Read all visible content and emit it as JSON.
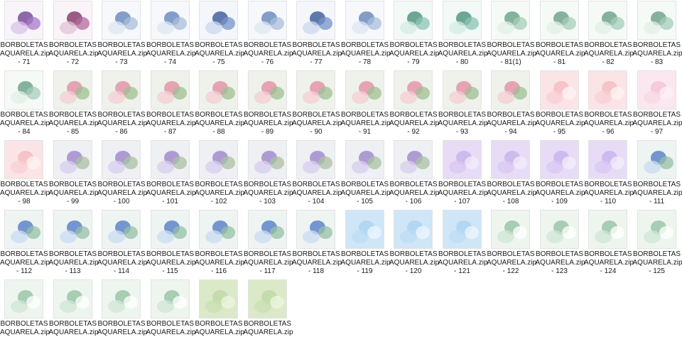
{
  "items": [
    {
      "name_line1": "BORBOLETAS",
      "name_line2": "AQUARELA.zip",
      "name_line3": "- 71",
      "theme": "purple-bouquet"
    },
    {
      "name_line1": "BORBOLETAS",
      "name_line2": "AQUARELA.zip",
      "name_line3": "- 72",
      "theme": "magenta-bouquet"
    },
    {
      "name_line1": "BORBOLETAS",
      "name_line2": "AQUARELA.zip",
      "name_line3": "- 73",
      "theme": "blue-bouquet"
    },
    {
      "name_line1": "BORBOLETAS",
      "name_line2": "AQUARELA.zip",
      "name_line3": "- 74",
      "theme": "blue-bouquet"
    },
    {
      "name_line1": "BORBOLETAS",
      "name_line2": "AQUARELA.zip",
      "name_line3": "- 75",
      "theme": "navy-bouquet"
    },
    {
      "name_line1": "BORBOLETAS",
      "name_line2": "AQUARELA.zip",
      "name_line3": "- 76",
      "theme": "blue-bouquet"
    },
    {
      "name_line1": "BORBOLETAS",
      "name_line2": "AQUARELA.zip",
      "name_line3": "- 77",
      "theme": "navy-bouquet"
    },
    {
      "name_line1": "BORBOLETAS",
      "name_line2": "AQUARELA.zip",
      "name_line3": "- 78",
      "theme": "blue-bouquet"
    },
    {
      "name_line1": "BORBOLETAS",
      "name_line2": "AQUARELA.zip",
      "name_line3": "- 79",
      "theme": "teal-bouquet"
    },
    {
      "name_line1": "BORBOLETAS",
      "name_line2": "AQUARELA.zip",
      "name_line3": "- 80",
      "theme": "teal-bouquet"
    },
    {
      "name_line1": "BORBOLETAS",
      "name_line2": "AQUARELA.zip",
      "name_line3": "- 81(1)",
      "theme": "green-bouquet"
    },
    {
      "name_line1": "BORBOLETAS",
      "name_line2": "AQUARELA.zip",
      "name_line3": "- 81",
      "theme": "green-bouquet"
    },
    {
      "name_line1": "BORBOLETAS",
      "name_line2": "AQUARELA.zip",
      "name_line3": "- 82",
      "theme": "green-bouquet"
    },
    {
      "name_line1": "BORBOLETAS",
      "name_line2": "AQUARELA.zip",
      "name_line3": "- 83",
      "theme": "green-bouquet"
    },
    {
      "name_line1": "BORBOLETAS",
      "name_line2": "AQUARELA.zip",
      "name_line3": "- 84",
      "theme": "green-bouquet"
    },
    {
      "name_line1": "BORBOLETAS",
      "name_line2": "AQUARELA.zip",
      "name_line3": "- 85",
      "theme": "pink-garden"
    },
    {
      "name_line1": "BORBOLETAS",
      "name_line2": "AQUARELA.zip",
      "name_line3": "- 86",
      "theme": "pink-garden"
    },
    {
      "name_line1": "BORBOLETAS",
      "name_line2": "AQUARELA.zip",
      "name_line3": "- 87",
      "theme": "pink-garden"
    },
    {
      "name_line1": "BORBOLETAS",
      "name_line2": "AQUARELA.zip",
      "name_line3": "- 88",
      "theme": "pink-garden"
    },
    {
      "name_line1": "BORBOLETAS",
      "name_line2": "AQUARELA.zip",
      "name_line3": "- 89",
      "theme": "pink-garden"
    },
    {
      "name_line1": "BORBOLETAS",
      "name_line2": "AQUARELA.zip",
      "name_line3": "- 90",
      "theme": "pink-garden"
    },
    {
      "name_line1": "BORBOLETAS",
      "name_line2": "AQUARELA.zip",
      "name_line3": "- 91",
      "theme": "pink-garden"
    },
    {
      "name_line1": "BORBOLETAS",
      "name_line2": "AQUARELA.zip",
      "name_line3": "- 92",
      "theme": "pink-garden"
    },
    {
      "name_line1": "BORBOLETAS",
      "name_line2": "AQUARELA.zip",
      "name_line3": "- 93",
      "theme": "pink-garden"
    },
    {
      "name_line1": "BORBOLETAS",
      "name_line2": "AQUARELA.zip",
      "name_line3": "- 94",
      "theme": "pink-garden"
    },
    {
      "name_line1": "BORBOLETAS",
      "name_line2": "AQUARELA.zip",
      "name_line3": "- 95",
      "theme": "pink-paper"
    },
    {
      "name_line1": "BORBOLETAS",
      "name_line2": "AQUARELA.zip",
      "name_line3": "- 96",
      "theme": "pink-paper"
    },
    {
      "name_line1": "BORBOLETAS",
      "name_line2": "AQUARELA.zip",
      "name_line3": "- 97",
      "theme": "pink-grid"
    },
    {
      "name_line1": "BORBOLETAS",
      "name_line2": "AQUARELA.zip",
      "name_line3": "- 98",
      "theme": "pink-paper"
    },
    {
      "name_line1": "BORBOLETAS",
      "name_line2": "AQUARELA.zip",
      "name_line3": "- 99",
      "theme": "lavender-garden"
    },
    {
      "name_line1": "BORBOLETAS",
      "name_line2": "AQUARELA.zip",
      "name_line3": "- 100",
      "theme": "lavender-garden"
    },
    {
      "name_line1": "BORBOLETAS",
      "name_line2": "AQUARELA.zip",
      "name_line3": "- 101",
      "theme": "lavender-garden"
    },
    {
      "name_line1": "BORBOLETAS",
      "name_line2": "AQUARELA.zip",
      "name_line3": "- 102",
      "theme": "lavender-garden"
    },
    {
      "name_line1": "BORBOLETAS",
      "name_line2": "AQUARELA.zip",
      "name_line3": "- 103",
      "theme": "lavender-garden"
    },
    {
      "name_line1": "BORBOLETAS",
      "name_line2": "AQUARELA.zip",
      "name_line3": "- 104",
      "theme": "lavender-garden"
    },
    {
      "name_line1": "BORBOLETAS",
      "name_line2": "AQUARELA.zip",
      "name_line3": "- 105",
      "theme": "lavender-garden"
    },
    {
      "name_line1": "BORBOLETAS",
      "name_line2": "AQUARELA.zip",
      "name_line3": "- 106",
      "theme": "lavender-garden"
    },
    {
      "name_line1": "BORBOLETAS",
      "name_line2": "AQUARELA.zip",
      "name_line3": "- 107",
      "theme": "lilac-paper"
    },
    {
      "name_line1": "BORBOLETAS",
      "name_line2": "AQUARELA.zip",
      "name_line3": "- 108",
      "theme": "lilac-paper"
    },
    {
      "name_line1": "BORBOLETAS",
      "name_line2": "AQUARELA.zip",
      "name_line3": "- 109",
      "theme": "lilac-paper"
    },
    {
      "name_line1": "BORBOLETAS",
      "name_line2": "AQUARELA.zip",
      "name_line3": "- 110",
      "theme": "lilac-paper"
    },
    {
      "name_line1": "BORBOLETAS",
      "name_line2": "AQUARELA.zip",
      "name_line3": "- 111",
      "theme": "blue-garden"
    },
    {
      "name_line1": "BORBOLETAS",
      "name_line2": "AQUARELA.zip",
      "name_line3": "- 112",
      "theme": "blue-garden"
    },
    {
      "name_line1": "BORBOLETAS",
      "name_line2": "AQUARELA.zip",
      "name_line3": "- 113",
      "theme": "blue-garden"
    },
    {
      "name_line1": "BORBOLETAS",
      "name_line2": "AQUARELA.zip",
      "name_line3": "- 114",
      "theme": "blue-garden"
    },
    {
      "name_line1": "BORBOLETAS",
      "name_line2": "AQUARELA.zip",
      "name_line3": "- 115",
      "theme": "blue-garden"
    },
    {
      "name_line1": "BORBOLETAS",
      "name_line2": "AQUARELA.zip",
      "name_line3": "- 116",
      "theme": "blue-garden"
    },
    {
      "name_line1": "BORBOLETAS",
      "name_line2": "AQUARELA.zip",
      "name_line3": "- 117",
      "theme": "blue-garden"
    },
    {
      "name_line1": "BORBOLETAS",
      "name_line2": "AQUARELA.zip",
      "name_line3": "- 118",
      "theme": "blue-garden"
    },
    {
      "name_line1": "BORBOLETAS",
      "name_line2": "AQUARELA.zip",
      "name_line3": "- 119",
      "theme": "sky-paper"
    },
    {
      "name_line1": "BORBOLETAS",
      "name_line2": "AQUARELA.zip",
      "name_line3": "- 120",
      "theme": "sky-paper"
    },
    {
      "name_line1": "BORBOLETAS",
      "name_line2": "AQUARELA.zip",
      "name_line3": "- 121",
      "theme": "sky-paper"
    },
    {
      "name_line1": "BORBOLETAS",
      "name_line2": "AQUARELA.zip",
      "name_line3": "- 122",
      "theme": "white-garden"
    },
    {
      "name_line1": "BORBOLETAS",
      "name_line2": "AQUARELA.zip",
      "name_line3": "- 123",
      "theme": "white-garden"
    },
    {
      "name_line1": "BORBOLETAS",
      "name_line2": "AQUARELA.zip",
      "name_line3": "- 124",
      "theme": "white-garden"
    },
    {
      "name_line1": "BORBOLETAS",
      "name_line2": "AQUARELA.zip",
      "name_line3": "- 125",
      "theme": "white-garden"
    },
    {
      "name_line1": "BORBOLETAS",
      "name_line2": "AQUARELA.zip",
      "name_line3": "",
      "theme": "white-garden"
    },
    {
      "name_line1": "BORBOLETAS",
      "name_line2": "AQUARELA.zip",
      "name_line3": "",
      "theme": "white-garden"
    },
    {
      "name_line1": "BORBOLETAS",
      "name_line2": "AQUARELA.zip",
      "name_line3": "",
      "theme": "white-garden"
    },
    {
      "name_line1": "BORBOLETAS",
      "name_line2": "AQUARELA.zip",
      "name_line3": "",
      "theme": "white-garden"
    },
    {
      "name_line1": "BORBOLETAS",
      "name_line2": "AQUARELA.zip",
      "name_line3": "",
      "theme": "green-paper"
    },
    {
      "name_line1": "BORBOLETAS",
      "name_line2": "AQUARELA.zip",
      "name_line3": "",
      "theme": "green-paper"
    }
  ],
  "themes": {
    "purple-bouquet": {
      "bg": "#f8f4fa",
      "a": "#6b3a8c",
      "b": "#a979c9",
      "c": "#d9c4e8"
    },
    "magenta-bouquet": {
      "bg": "#faf4f8",
      "a": "#7a2a5e",
      "b": "#b46aa0",
      "c": "#e2c3d8"
    },
    "blue-bouquet": {
      "bg": "#f6f8fb",
      "a": "#5b7fb5",
      "b": "#a8bfdc",
      "c": "#dde7f3"
    },
    "navy-bouquet": {
      "bg": "#f4f6fb",
      "a": "#2e4f94",
      "b": "#7593c9",
      "c": "#cbd8ee"
    },
    "teal-bouquet": {
      "bg": "#f3f9f7",
      "a": "#3d8a78",
      "b": "#8cc4b4",
      "c": "#d4ebe4"
    },
    "green-bouquet": {
      "bg": "#f6faf7",
      "a": "#5f9a80",
      "b": "#a6cdb8",
      "c": "#e1efe7"
    },
    "pink-garden": {
      "bg": "#eef2ea",
      "a": "#e38aa0",
      "b": "#9fbf93",
      "c": "#f4cdd6"
    },
    "pink-paper": {
      "bg": "#fbe4e6",
      "a": "#f4b8bf",
      "b": "#fff4f3",
      "c": "#f8d0d4"
    },
    "pink-grid": {
      "bg": "#fbe7ef",
      "a": "#f3c2d3",
      "b": "#fcf2f6",
      "c": "#f7d9e4"
    },
    "lavender-garden": {
      "bg": "#eef0f3",
      "a": "#9a7fc8",
      "b": "#a9c2a2",
      "c": "#d7cdee"
    },
    "lilac-paper": {
      "bg": "#e7dcf6",
      "a": "#c6afe9",
      "b": "#f3edfb",
      "c": "#d9c7f2"
    },
    "blue-garden": {
      "bg": "#eef4f1",
      "a": "#4a77c4",
      "b": "#95c0a5",
      "c": "#c9dcf3"
    },
    "sky-paper": {
      "bg": "#cfe6f6",
      "a": "#a8d1f0",
      "b": "#eef7fd",
      "c": "#bcdcf4"
    },
    "white-garden": {
      "bg": "#eef5ef",
      "a": "#8fbf9d",
      "b": "#ffffff",
      "c": "#cfe5d5"
    },
    "green-paper": {
      "bg": "#dbe9c8",
      "a": "#bcd6a2",
      "b": "#eef5e3",
      "c": "#c9dfb2"
    }
  }
}
